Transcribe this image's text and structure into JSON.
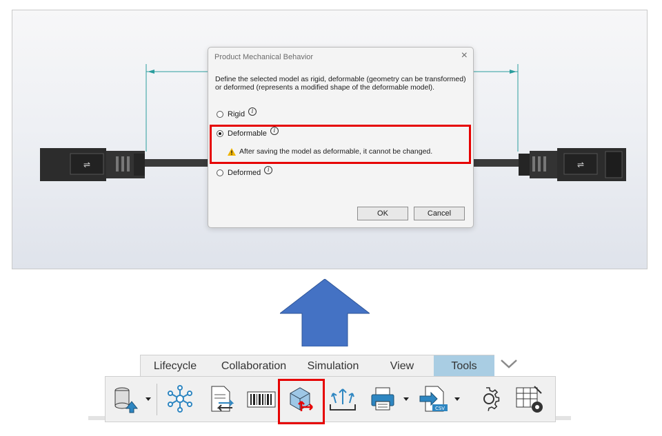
{
  "dialog": {
    "title": "Product Mechanical Behavior",
    "description": "Define the selected model as rigid, deformable (geometry can be transformed) or deformed (represents a modified shape of the deformable model).",
    "options": [
      {
        "label": "Rigid",
        "selected": false
      },
      {
        "label": "Deformable",
        "selected": true
      },
      {
        "label": "Deformed",
        "selected": false
      }
    ],
    "warning": "After saving the model as deformable, it cannot be changed.",
    "ok_label": "OK",
    "cancel_label": "Cancel",
    "info_glyph": "i",
    "close_glyph": "×"
  },
  "tabs": [
    {
      "label": "Lifecycle",
      "active": false
    },
    {
      "label": "Collaboration",
      "active": false
    },
    {
      "label": "Simulation",
      "active": false
    },
    {
      "label": "View",
      "active": false
    },
    {
      "label": "Tools",
      "active": true
    }
  ],
  "toolbar_icons": [
    "database-import-icon",
    "network-nodes-icon",
    "document-transfer-icon",
    "barcode-icon",
    "mechanical-behavior-icon",
    "upload-export-icon",
    "print-icon",
    "csv-export-icon",
    "settings-gear-icon",
    "table-settings-icon"
  ],
  "colors": {
    "highlight": "#e60000",
    "arrow": "#4472c4",
    "active_tab": "#a9cde3"
  }
}
